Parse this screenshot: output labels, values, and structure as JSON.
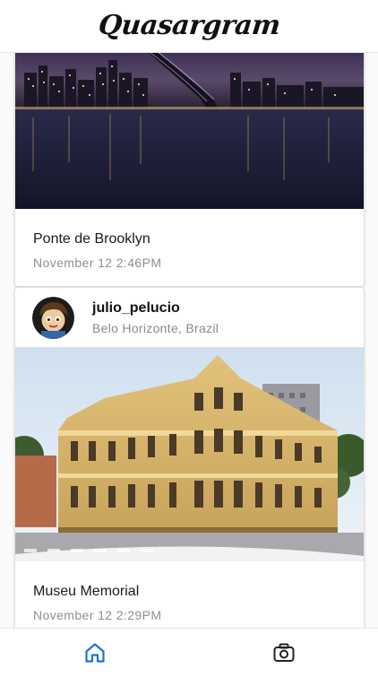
{
  "app": {
    "title": "Quasargram",
    "accent_color": "#1976d2"
  },
  "feed": {
    "posts": [
      {
        "caption": "Ponte de Brooklyn",
        "timestamp": "November 12 2:46PM",
        "image": "brooklyn-bridge-night-photo"
      },
      {
        "username": "julio_pelucio",
        "location": "Belo Horizonte, Brazil",
        "caption": "Museu Memorial",
        "timestamp": "November 12 2:29PM",
        "image": "museu-memorial-building-photo"
      }
    ]
  },
  "bottom_nav": {
    "items": [
      {
        "icon": "home-icon",
        "active": true
      },
      {
        "icon": "camera-icon",
        "active": false
      }
    ]
  }
}
